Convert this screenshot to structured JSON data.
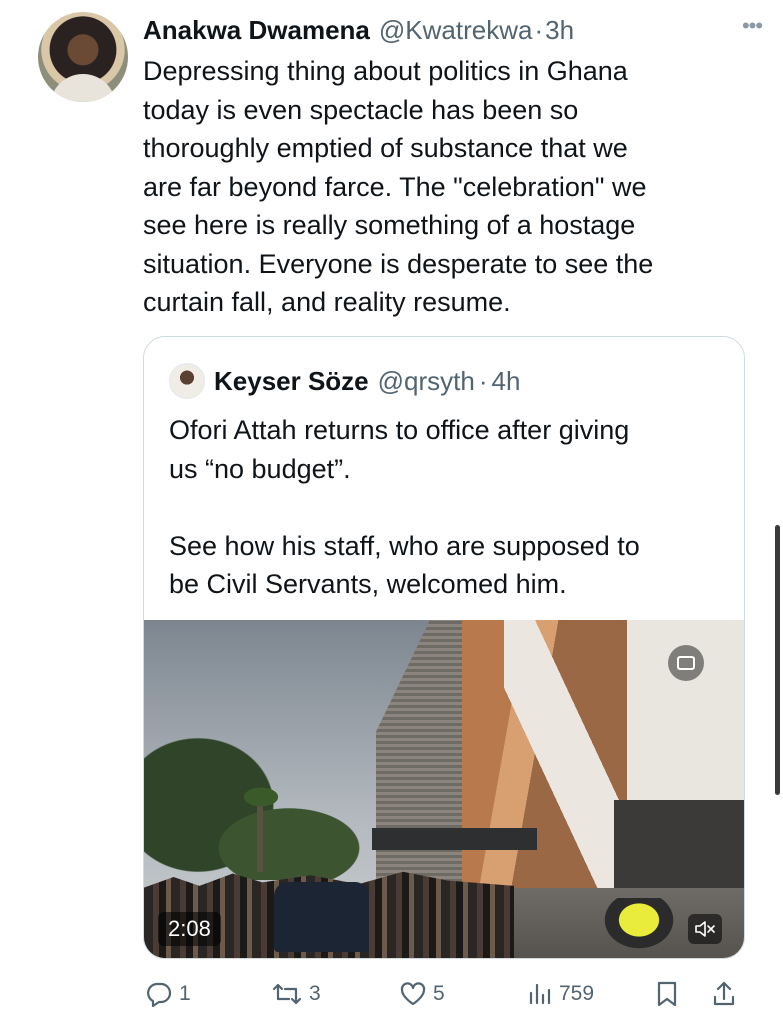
{
  "tweet": {
    "author_name": "Anakwa Dwamena",
    "author_handle": "@Kwatrekwa",
    "separator": "·",
    "time_ago": "3h",
    "text": "Depressing thing about politics in Ghana\ntoday is even spectacle has been so\nthoroughly emptied of substance that we\nare far beyond farce. The \"celebration\" we\nsee here is really something of a hostage\nsituation. Everyone is desperate to see the\ncurtain fall, and reality resume."
  },
  "quoted_tweet": {
    "author_name": "Keyser Söze",
    "author_handle": "@qrsyth",
    "separator": "·",
    "time_ago": "4h",
    "text": "Ofori Attah returns to office after giving\nus “no budget”.\n\nSee how his staff, who are supposed to\nbe Civil Servants, welcomed him.",
    "video": {
      "duration": "2:08",
      "captions_icon": "closed-captions-icon",
      "mute_icon": "muted-speaker-icon"
    }
  },
  "actions": {
    "replies": "1",
    "reposts": "3",
    "likes": "5",
    "views": "759"
  },
  "colors": {
    "text": "#0f1419",
    "secondary": "#536471",
    "border": "#cfd9de"
  }
}
